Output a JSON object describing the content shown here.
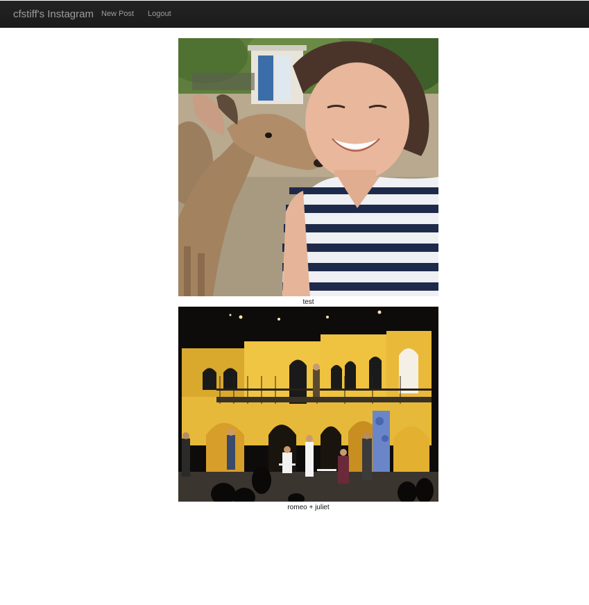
{
  "navbar": {
    "brand": "cfstiff's Instagram",
    "links": [
      {
        "label": "New Post"
      },
      {
        "label": "Logout"
      }
    ]
  },
  "posts": [
    {
      "caption": "test",
      "image": "selfie-with-deer-photo"
    },
    {
      "caption": "romeo + juliet",
      "image": "theater-stage-photo"
    }
  ],
  "colors": {
    "navbar_bg": "#222222",
    "navbar_text": "#9d9d9d"
  }
}
